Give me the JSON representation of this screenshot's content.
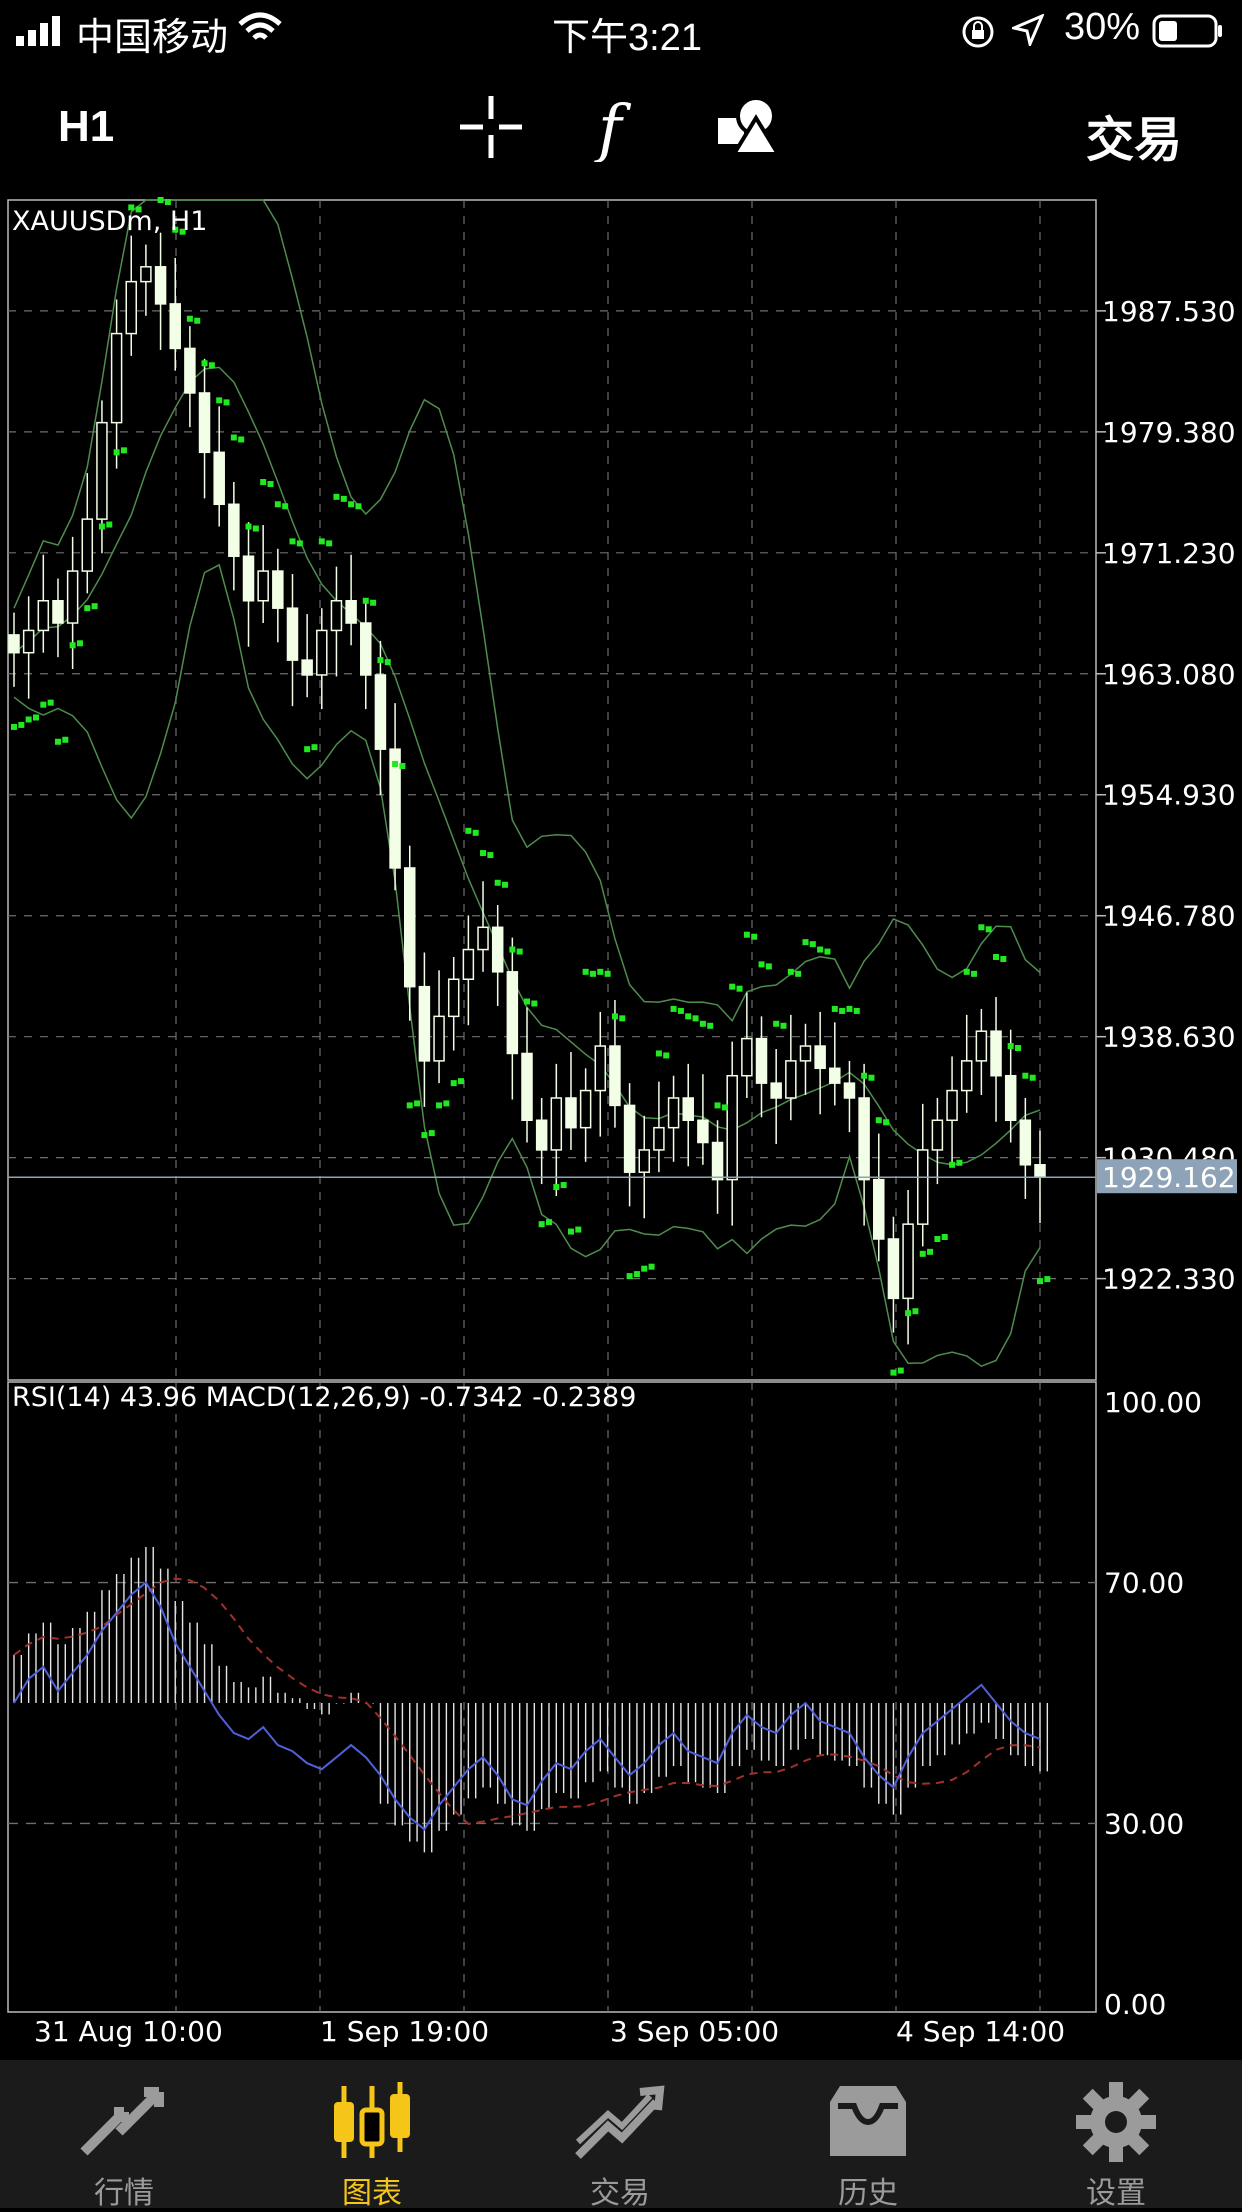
{
  "status_bar": {
    "carrier": "中国移动",
    "time": "下午3:21",
    "battery": "30%"
  },
  "toolbar": {
    "timeframe": "H1",
    "trade_label": "交易",
    "icons": [
      "crosshair-icon",
      "function-icon",
      "objects-icon"
    ]
  },
  "chart": {
    "symbol_label": "XAUUSDm, H1",
    "current_price": "1929.162",
    "price_ticks": [
      "1987.530",
      "1979.380",
      "1971.230",
      "1963.080",
      "1954.930",
      "1946.780",
      "1938.630",
      "1930.480",
      "1922.330"
    ],
    "indicator_label": "RSI(14) 43.96 MACD(12,26,9) -0.7342 -0.2389",
    "rsi_ticks": [
      "100.00",
      "70.00",
      "30.00",
      "0.00"
    ],
    "time_labels": [
      "31 Aug 10:00",
      "1 Sep 19:00",
      "3 Sep 05:00",
      "4 Sep 14:00"
    ],
    "colors": {
      "background": "#000000",
      "grid": "#6e6e6e",
      "candle": "#f2ffe6",
      "sar": "#22e822",
      "bands": "#4f8c4f",
      "rsi": "#5060d8",
      "macd_signal": "#a0302a",
      "current_price_bg": "#8fa3b8"
    }
  },
  "chart_data": {
    "type": "line",
    "title": "XAUUSDm, H1",
    "ylim": [
      1915.5,
      1995.0
    ],
    "grid": true,
    "x": [
      "31 Aug 10:00",
      "1 Sep 19:00",
      "3 Sep 05:00",
      "4 Sep 14:00"
    ],
    "series": [
      {
        "name": "XAUUSDm",
        "values": [
          1964.5,
          1966.0,
          1968.0,
          1966.5,
          1970.0,
          1973.5,
          1980.0,
          1986.0,
          1989.5,
          1990.5,
          1988.0,
          1985.0,
          1982.0,
          1978.0,
          1974.5,
          1971.0,
          1968.0,
          1970.0,
          1967.5,
          1964.0,
          1963.0,
          1966.0,
          1968.0,
          1966.5,
          1963.0,
          1958.0,
          1950.0,
          1942.0,
          1937.0,
          1940.0,
          1942.5,
          1944.5,
          1946.0,
          1943.0,
          1937.5,
          1933.0,
          1931.0,
          1934.5,
          1932.5,
          1935.0,
          1938.0,
          1934.0,
          1929.5,
          1931.0,
          1932.5,
          1934.5,
          1933.0,
          1931.5,
          1929.0,
          1936.0,
          1938.5,
          1935.5,
          1934.5,
          1937.0,
          1938.0,
          1936.5,
          1935.5,
          1934.5,
          1929.0,
          1925.0,
          1921.0,
          1926.0,
          1931.0,
          1933.0,
          1935.0,
          1937.0,
          1939.0,
          1936.0,
          1933.0,
          1930.0,
          1929.162
        ]
      }
    ],
    "rsi": {
      "name": "RSI(14)",
      "value": 43.96,
      "ylim": [
        0,
        100
      ],
      "levels": [
        70,
        30
      ],
      "values": [
        50,
        54,
        56,
        52,
        55,
        58,
        62,
        65,
        68,
        70,
        66,
        60,
        56,
        52,
        48,
        45,
        44,
        46,
        43,
        42,
        40,
        39,
        41,
        43,
        41,
        38,
        34,
        31,
        29,
        33,
        36,
        39,
        41,
        38,
        34,
        33,
        37,
        40,
        39,
        42,
        44,
        41,
        38,
        40,
        43,
        45,
        42,
        41,
        40,
        45,
        48,
        46,
        45,
        48,
        50,
        47,
        46,
        45,
        41,
        38,
        36,
        41,
        45,
        47,
        49,
        51,
        53,
        50,
        47,
        45,
        44
      ]
    },
    "macd": {
      "name": "MACD(12,26,9)",
      "main": -0.7342,
      "signal": -0.2389
    }
  },
  "tab_bar": {
    "items": [
      {
        "label": "行情",
        "icon": "quotes-icon"
      },
      {
        "label": "图表",
        "icon": "chart-icon"
      },
      {
        "label": "交易",
        "icon": "trade-icon"
      },
      {
        "label": "历史",
        "icon": "history-icon"
      },
      {
        "label": "设置",
        "icon": "settings-icon"
      }
    ],
    "active_index": 1,
    "active_color": "#f5c518",
    "inactive_color": "#9b9b9b"
  }
}
